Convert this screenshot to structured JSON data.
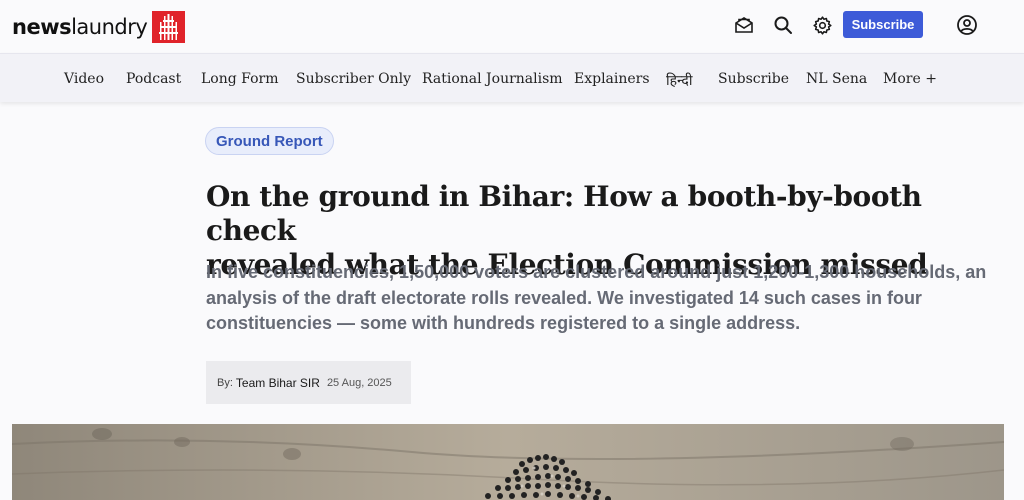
{
  "header": {
    "logo_news": "news",
    "logo_laundry": "laundry",
    "subscribe_label": "Subscribe",
    "icons": [
      "newsletter-icon",
      "search-icon",
      "gear-icon",
      "user-icon"
    ]
  },
  "nav": {
    "items": [
      "Video",
      "Podcast",
      "Long Form",
      "Subscriber Only",
      "Rational Journalism",
      "Explainers",
      "हिन्दी",
      "Subscribe",
      "NL Sena",
      "More +"
    ]
  },
  "article": {
    "tag": "Ground Report",
    "title_line1": "On the ground in Bihar: How a booth-by-booth check",
    "title_line2": "revealed what the Election Commission missed",
    "subhead": "In five constituencies, 1,50,000 voters are clustered around just 1,200-1,300 households, an analysis of the draft electorate rolls revealed. We investigated 14 such cases in four constituencies — some with hundreds registered to a single address.",
    "by_label": "By:",
    "author": "Team Bihar SIR",
    "date": "25 Aug, 2025"
  },
  "colors": {
    "accent": "#3d5bd8",
    "logo_red": "#e0232a",
    "tag_text": "#3757b8"
  }
}
